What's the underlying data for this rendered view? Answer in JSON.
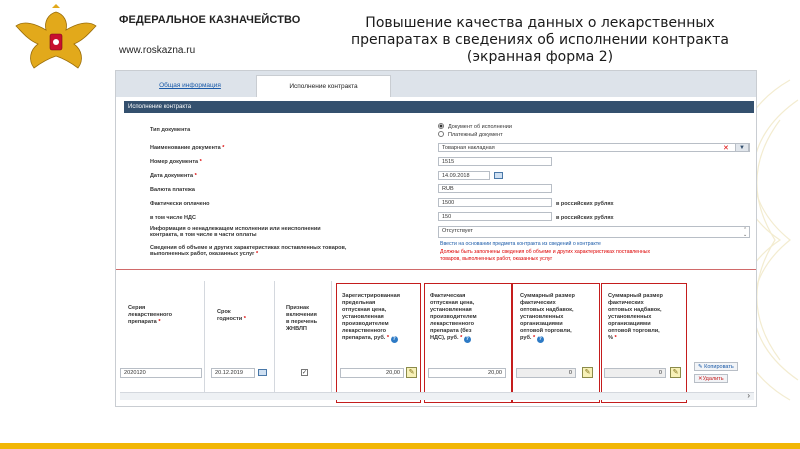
{
  "header": {
    "org_name": "ФЕДЕРАЛЬНОЕ КАЗНАЧЕЙСТВО",
    "site": "www.roskazna.ru",
    "title_line1": "Повышение качества данных о лекарственных",
    "title_line2": "препаратах в сведениях об исполнении контракта",
    "title_line3": "(экранная форма 2)"
  },
  "tabs": [
    {
      "label": "Общая информация",
      "active": false
    },
    {
      "label": "Исполнение контракта",
      "active": true
    }
  ],
  "section_title": "Исполнение контракта",
  "form": {
    "doc_type_label": "Тип документа",
    "radio_options": [
      {
        "label": "Документ об исполнении",
        "checked": true
      },
      {
        "label": "Платежный документ",
        "checked": false
      }
    ],
    "doc_name_label": "Наименование документа",
    "doc_name_value": "Товарная накладная",
    "doc_number_label": "Номер документа",
    "doc_number_value": "1515",
    "doc_date_label": "Дата документа",
    "doc_date_value": "14.09.2018",
    "currency_label": "Валюта платежа",
    "currency_value": "RUB",
    "paid_label": "Фактически оплачено",
    "paid_value": "1500",
    "paid_unit": "в российских рублях",
    "vat_label": "в том числе НДС",
    "vat_value": "150",
    "vat_unit": "в российских рублях",
    "improper_label_1": "Информация о ненадлежащем исполнении или неисполнении",
    "improper_label_2": "контракта, в том числе в части оплаты",
    "improper_value": "Отсутствует",
    "goods_label_1": "Сведения об объеме и других характеристиках поставленных товаров,",
    "goods_label_2": "выполненных работ, оказанных услуг",
    "hint_blue": "Ввести на основании предмета контракта из сведений о контракте",
    "hint_red_1": "Должны быть заполнены сведения об объеме и других характеристиках поставленных",
    "hint_red_2": "товаров, выполненных работ, оказанных услуг",
    "required_mark": "*"
  },
  "table": {
    "headers": {
      "series": [
        "Серия",
        "лекарственного",
        "препарата"
      ],
      "expiry": [
        "Срок",
        "годности"
      ],
      "jnvlp": [
        "Признак",
        "включения",
        "в перечень",
        "ЖНВЛП"
      ],
      "reg_price": [
        "Зарегистрированная",
        "предельная",
        "отпускная цена,",
        "установленная",
        "производителем",
        "лекарственного",
        "препарата, руб."
      ],
      "actual_price": [
        "Фактическая",
        "отпускная цена,",
        "установленная",
        "производителем",
        "лекарственного",
        "препарата (без",
        "НДС), руб."
      ],
      "wholesale_rub": [
        "Суммарный размер",
        "фактических",
        "оптовых надбавок,",
        "установленных",
        "организациями",
        "оптовой торговли,",
        "руб."
      ],
      "wholesale_pct": [
        "Суммарный размер",
        "фактических",
        "оптовых надбавок,",
        "установленных",
        "организациями",
        "оптовой торговли,",
        "%"
      ]
    },
    "row": {
      "series": "2020120",
      "expiry": "20.12.2019",
      "jnvlp_checked": true,
      "reg_price": "20,00",
      "actual_price": "20,00",
      "wholesale_rub": "0",
      "wholesale_pct": "0"
    },
    "actions": {
      "copy": "Копировать",
      "delete": "Удалить"
    }
  },
  "colors": {
    "accent_navy": "#34506e",
    "highlight_red": "#c41d1d",
    "link_blue": "#1a5aa8",
    "brand_gold": "#f2b705"
  }
}
